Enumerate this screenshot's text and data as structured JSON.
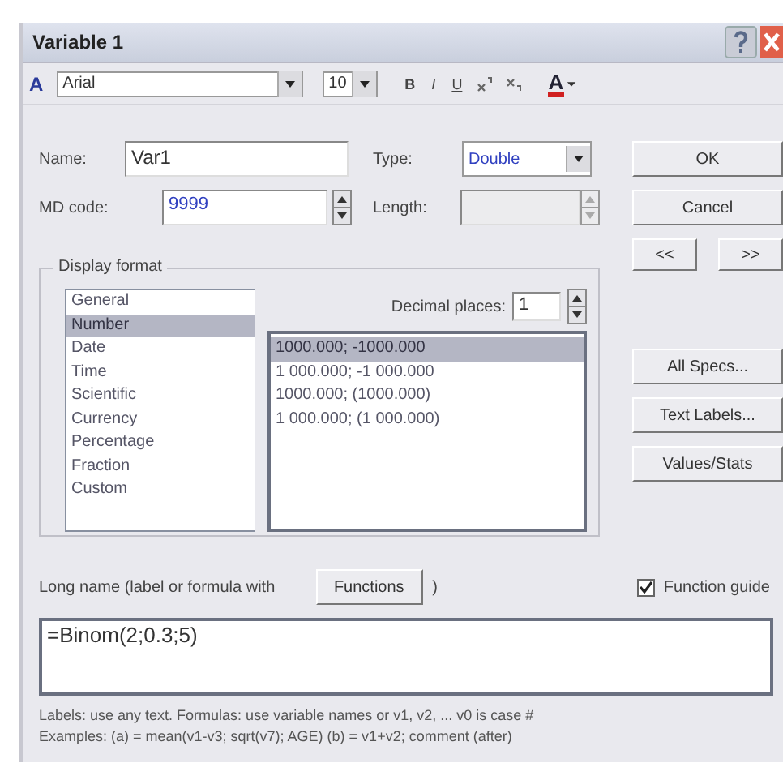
{
  "window": {
    "title": "Variable 1"
  },
  "toolbar": {
    "font_glyph": "A",
    "font": "Arial",
    "size": "10",
    "format_buttons": [
      "B",
      "I",
      "U"
    ],
    "color_glyph": "A"
  },
  "name": {
    "label": "Name:",
    "value": "Var1"
  },
  "type": {
    "label": "Type:",
    "value": "Double"
  },
  "md_code": {
    "label": "MD code:",
    "value": "9999"
  },
  "length": {
    "label": "Length:",
    "disabled": true
  },
  "buttons": {
    "ok": "OK",
    "cancel": "Cancel",
    "prev": "<<",
    "next": ">>",
    "all_specs": "All Specs...",
    "text_labels": "Text Labels...",
    "values_stats": "Values/Stats"
  },
  "display_format": {
    "title": "Display format",
    "categories": [
      {
        "label": "General",
        "selected": false
      },
      {
        "label": "Number",
        "selected": true
      },
      {
        "label": "Date",
        "selected": false
      },
      {
        "label": "Time",
        "selected": false
      },
      {
        "label": "Scientific",
        "selected": false
      },
      {
        "label": "Currency",
        "selected": false
      },
      {
        "label": "Percentage",
        "selected": false
      },
      {
        "label": "Fraction",
        "selected": false
      },
      {
        "label": "Custom",
        "selected": false
      }
    ],
    "decimal_places": {
      "label": "Decimal places:",
      "value": "1"
    },
    "formats": [
      {
        "label": "1000.000; -1000.000",
        "selected": true
      },
      {
        "label": "1 000.000; -1 000.000",
        "selected": false
      },
      {
        "label": "1000.000; (1000.000)",
        "selected": false
      },
      {
        "label": "1 000.000; (1 000.000)",
        "selected": false
      }
    ]
  },
  "long_name": {
    "label": "Long name (label or formula with",
    "functions_button": "Functions",
    "closing": ")",
    "function_guide": {
      "label": "Function guide",
      "checked": true
    },
    "value": "=Binom(2;0.3;5)"
  },
  "help_lines": [
    "Labels: use any text. Formulas: use variable names or v1, v2, ... v0 is case #",
    "Examples:   (a) = mean(v1-v3; sqrt(v7); AGE)   (b) = v1+v2; comment (after)"
  ]
}
